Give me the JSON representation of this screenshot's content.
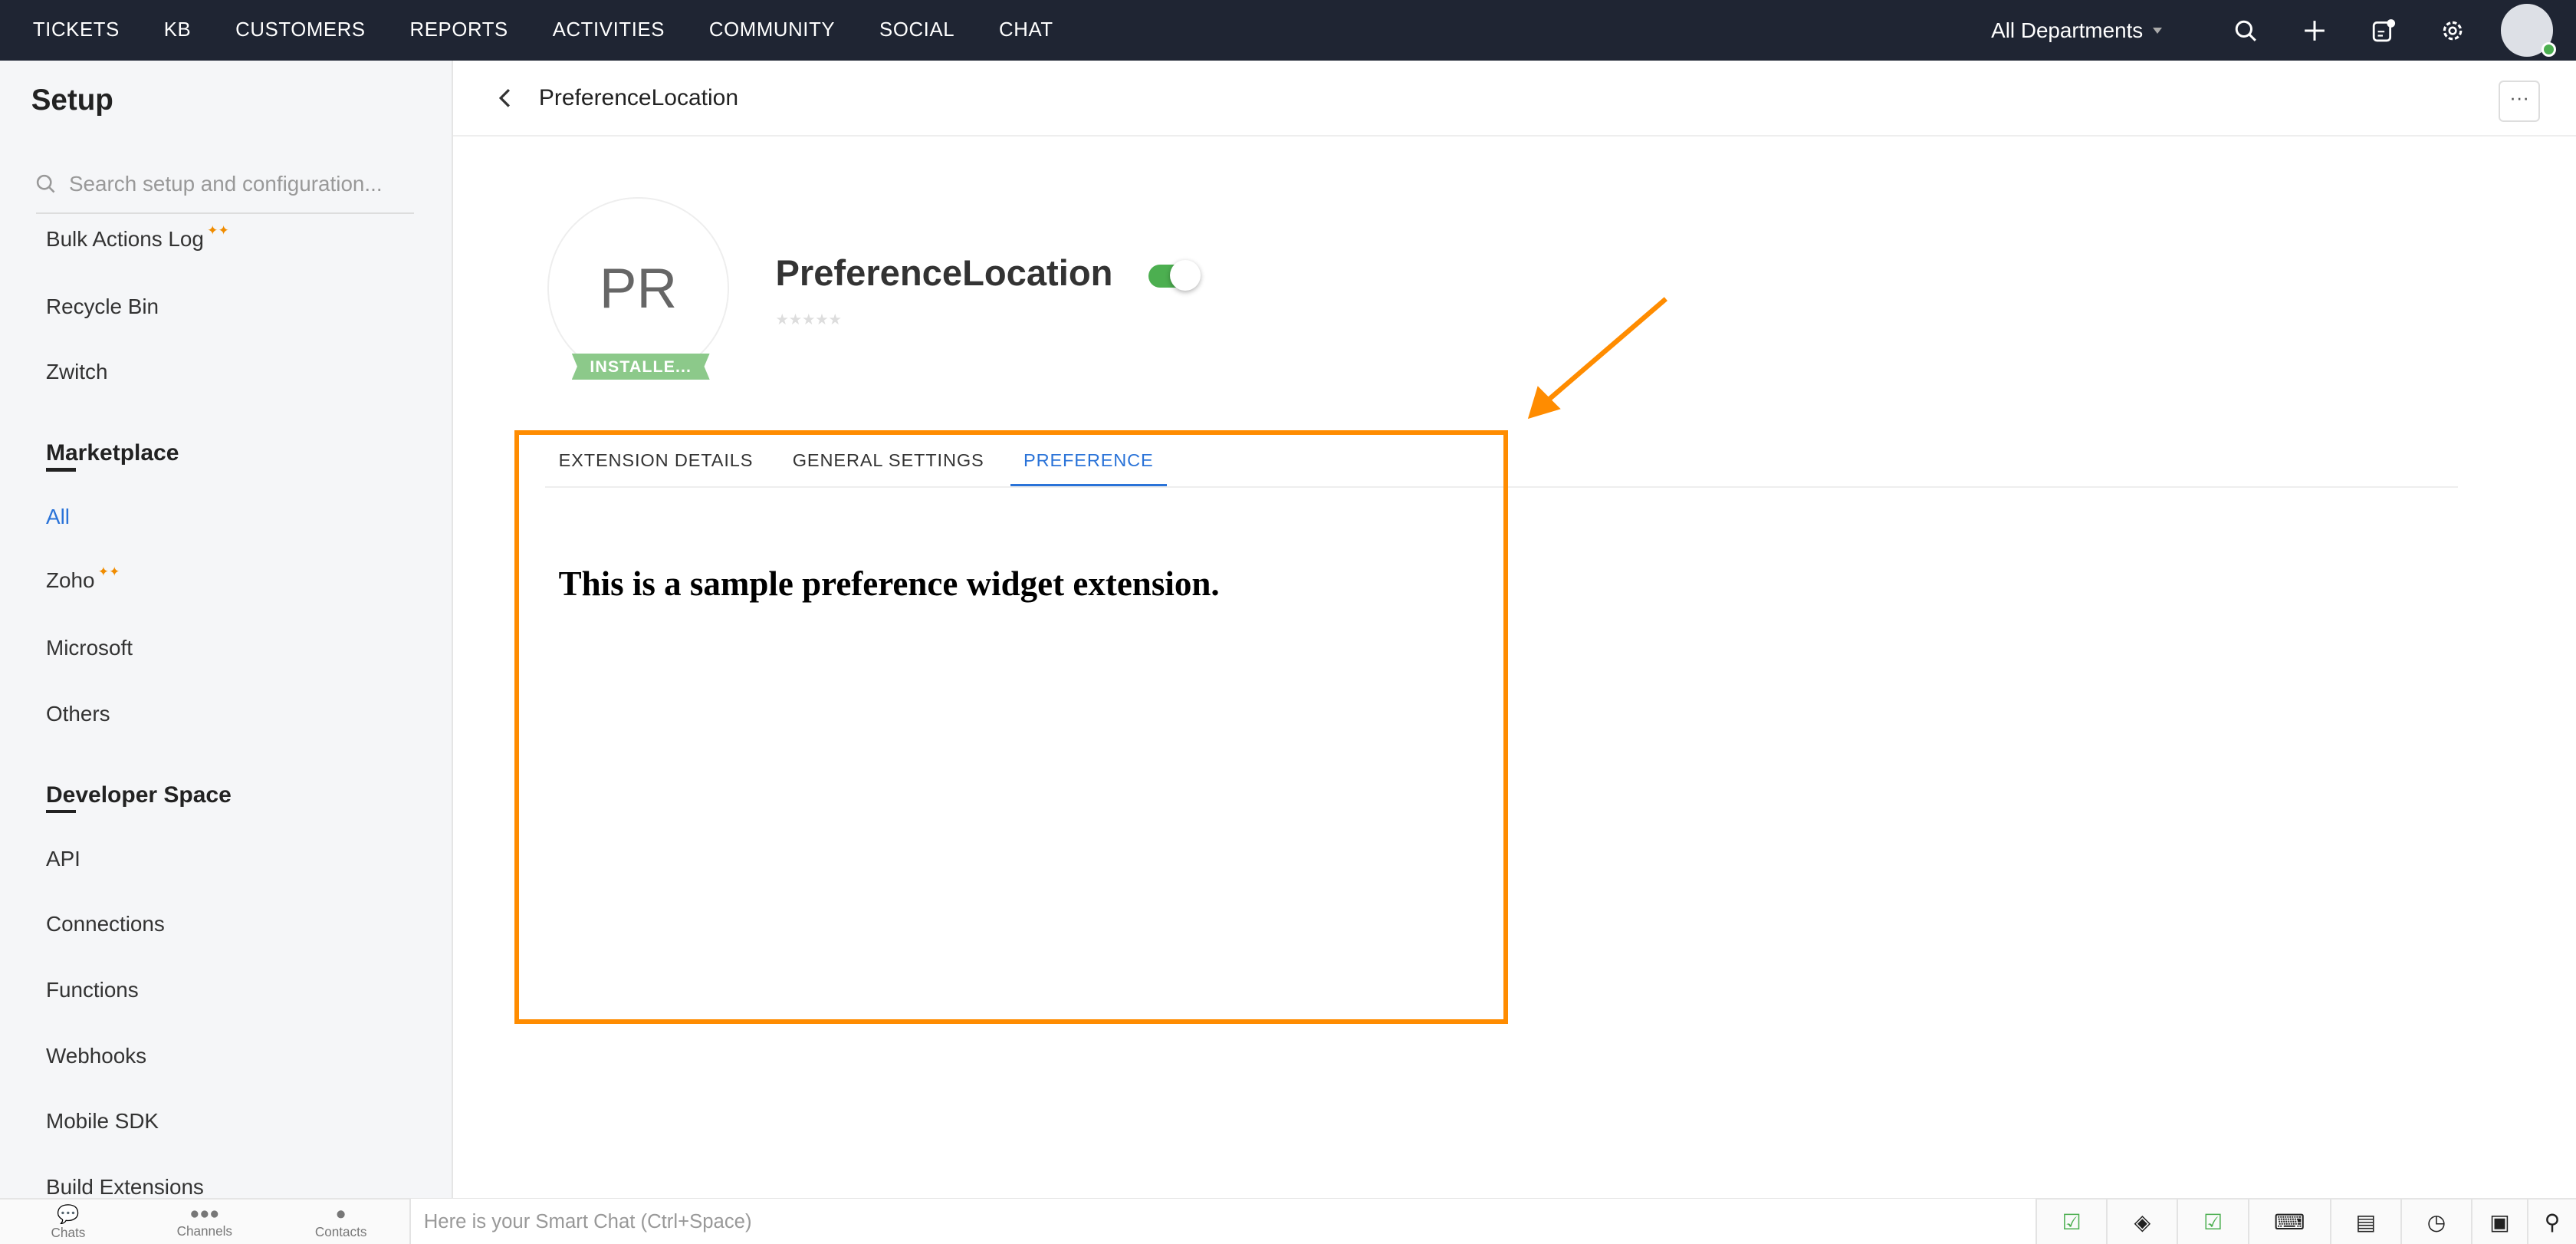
{
  "topbar": {
    "nav": [
      "TICKETS",
      "KB",
      "CUSTOMERS",
      "REPORTS",
      "ACTIVITIES",
      "COMMUNITY",
      "SOCIAL",
      "CHAT"
    ],
    "department": "All Departments",
    "icons": [
      "search-icon",
      "plus-icon",
      "compose-icon",
      "gear-icon"
    ]
  },
  "sidebar": {
    "title": "Setup",
    "search_placeholder": "Search setup and configuration...",
    "items_top": [
      "Bulk Actions Log",
      "Recycle Bin",
      "Zwitch"
    ],
    "marketplace": {
      "heading": "Marketplace",
      "items": [
        "All",
        "Zoho",
        "Microsoft",
        "Others"
      ]
    },
    "developer": {
      "heading": "Developer Space",
      "items": [
        "API",
        "Connections",
        "Functions",
        "Webhooks",
        "Mobile SDK",
        "Build Extensions"
      ]
    }
  },
  "header": {
    "title": "PreferenceLocation",
    "more": "···"
  },
  "app": {
    "initials": "PR",
    "status": "INSTALLE...",
    "name": "PreferenceLocation",
    "enabled": true,
    "rating": 0,
    "stars": "★★★★★"
  },
  "tabs": [
    "EXTENSION DETAILS",
    "GENERAL SETTINGS",
    "PREFERENCE"
  ],
  "active_tab": "PREFERENCE",
  "widget_text": "This is a sample preference widget extension.",
  "highlight_color": "#ff8c00",
  "bottombar": {
    "items": [
      "Chats",
      "Channels",
      "Contacts"
    ],
    "chat_placeholder": "Here is your Smart Chat (Ctrl+Space)"
  }
}
